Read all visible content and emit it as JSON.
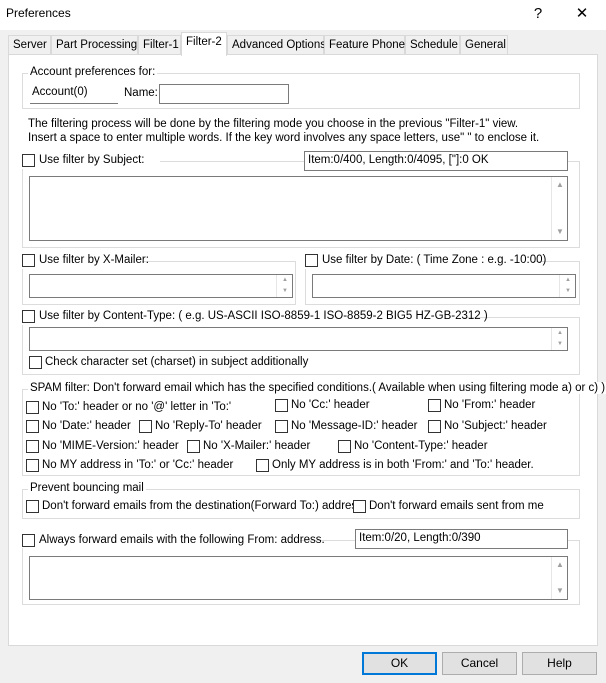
{
  "window": {
    "title": "Preferences",
    "help_glyph": "?",
    "close_glyph": "✕"
  },
  "tabs": [
    "Server",
    "Part Processing",
    "Filter-1",
    "Filter-2",
    "Advanced Options",
    "Feature Phone",
    "Schedule",
    "General"
  ],
  "active_tab": "Filter-2",
  "account": {
    "legend": "Account preferences for:",
    "account_value": "Account(0)",
    "name_label": "Name:",
    "name_value": ""
  },
  "info_text": {
    "line1": "The filtering process will be done by the filtering mode you choose in the previous \"Filter-1\" view.",
    "line2": "Insert a space to enter multiple words. If the key word involves any space letters, use\" \" to enclose it."
  },
  "subject_filter": {
    "label": "Use filter by Subject:",
    "checked": false,
    "info": "Item:0/400, Length:0/4095, [\"]:0 OK"
  },
  "xmailer_filter": {
    "label": "Use filter by X-Mailer:",
    "checked": false
  },
  "date_filter": {
    "label": "Use filter by Date: ( Time Zone : e.g. -10:00)",
    "checked": false
  },
  "content_type_filter": {
    "label": "Use filter by Content-Type: ( e.g. US-ASCII  ISO-8859-1  ISO-8859-2  BIG5  HZ-GB-2312 )",
    "checked": false,
    "charset_label": "Check character set (charset) in subject additionally",
    "charset_checked": false
  },
  "spam": {
    "legend": "SPAM filter: Don't forward email which has the specified conditions.( Available when using filtering mode a) or c) )",
    "options": [
      "No 'To:' header or no '@' letter in 'To:'",
      "No 'Cc:' header",
      "No 'From:' header",
      "No 'Date:' header",
      "No 'Reply-To' header",
      "No 'Message-ID:' header",
      "No 'Subject:' header",
      "No 'MIME-Version:' header",
      "No 'X-Mailer:' header",
      "No 'Content-Type:' header",
      "No MY address in 'To:' or 'Cc:' header",
      "Only MY address is in both 'From:' and 'To:' header."
    ]
  },
  "bounce": {
    "legend": "Prevent bouncing mail",
    "option1": "Don't forward emails from the destination(Forward To:) address.",
    "option2": "Don't forward emails sent from me"
  },
  "always_forward": {
    "label": "Always forward emails with the following From: address.",
    "checked": false,
    "info": "Item:0/20,  Length:0/390"
  },
  "buttons": {
    "ok": "OK",
    "cancel": "Cancel",
    "help": "Help"
  }
}
